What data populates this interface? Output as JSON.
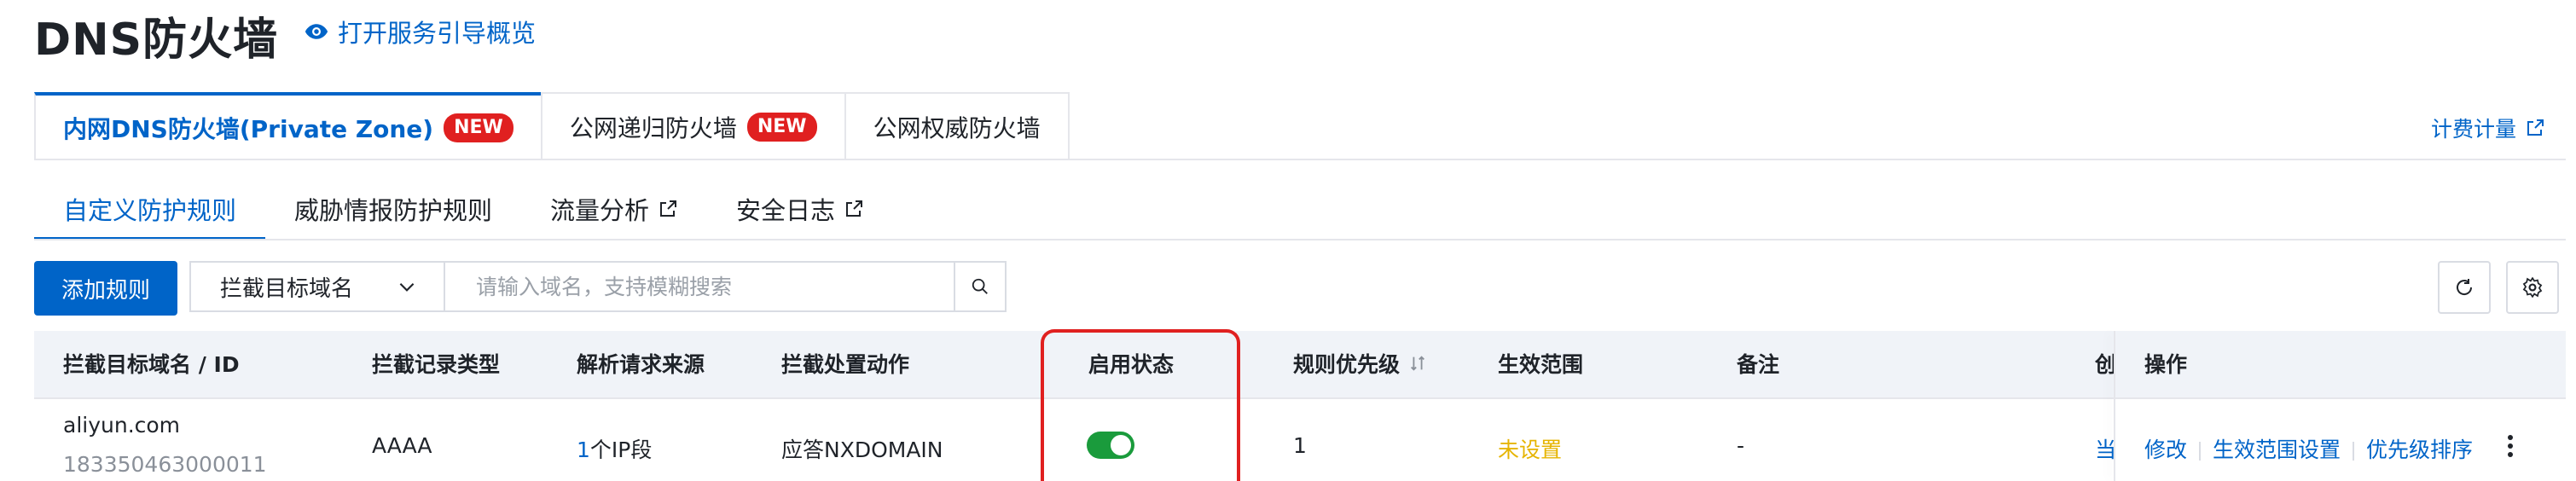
{
  "header": {
    "title": "DNS防火墙",
    "guide_link": "打开服务引导概览",
    "billing_link": "计费计量"
  },
  "top_tabs": [
    {
      "label": "内网DNS防火墙(Private Zone)",
      "badge": "NEW",
      "active": true
    },
    {
      "label": "公网递归防火墙",
      "badge": "NEW",
      "active": false
    },
    {
      "label": "公网权威防火墙",
      "badge": "",
      "active": false
    }
  ],
  "sub_tabs": [
    {
      "label": "自定义防护规则",
      "external": false,
      "active": true
    },
    {
      "label": "威胁情报防护规则",
      "external": false,
      "active": false
    },
    {
      "label": "流量分析",
      "external": true,
      "active": false
    },
    {
      "label": "安全日志",
      "external": true,
      "active": false
    }
  ],
  "toolbar": {
    "add_button": "添加规则",
    "filter_select": "拦截目标域名",
    "search_placeholder": "请输入域名，支持模糊搜索"
  },
  "table": {
    "columns": [
      "拦截目标域名 / ID",
      "拦截记录类型",
      "解析请求来源",
      "拦截处置动作",
      "启用状态",
      "规则优先级",
      "生效范围",
      "备注",
      "创",
      "操作"
    ],
    "priority_sort_icon": "sort-icon",
    "rows": [
      {
        "domain": "aliyun.com",
        "id": "183350463000011",
        "record_type": "AAAA",
        "source_count": "1",
        "source_suffix": "个IP段",
        "action": "应答NXDOMAIN",
        "enabled": true,
        "priority": "1",
        "scope": "未设置",
        "note": "-",
        "created_partial": "当",
        "ops": [
          "修改",
          "生效范围设置",
          "优先级排序"
        ]
      }
    ]
  },
  "colors": {
    "accent": "#0064c8",
    "badge": "#e02020",
    "toggle_on": "#1a9b3c",
    "scope_unset": "#e6b400",
    "highlight": "#e02020"
  }
}
